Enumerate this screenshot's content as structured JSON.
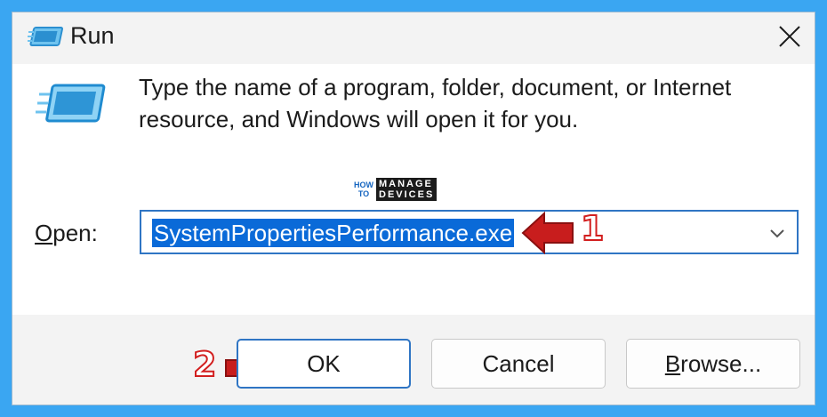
{
  "window": {
    "title": "Run",
    "close_glyph": "✕",
    "title_icon": "run-icon"
  },
  "dialog": {
    "description_line1": "Type the name of a program, folder, document, or Internet",
    "description_line2": "resource, and Windows will open it for you.",
    "big_icon": "run-icon",
    "open_label_underlined": "O",
    "open_label_rest": "pen:",
    "open_value": "SystemPropertiesPerformance.exe",
    "dropdown_icon": "chevron-down-icon"
  },
  "watermark": {
    "small_top": "HOW",
    "small_bottom": "TO",
    "big_top": "MANAGE",
    "big_bottom": "DEVICES"
  },
  "annotations": {
    "step1": "1",
    "step2": "2",
    "color": "#d21f1f"
  },
  "buttons": {
    "ok": "OK",
    "cancel": "Cancel",
    "browse_underlined": "B",
    "browse_rest": "rowse..."
  }
}
